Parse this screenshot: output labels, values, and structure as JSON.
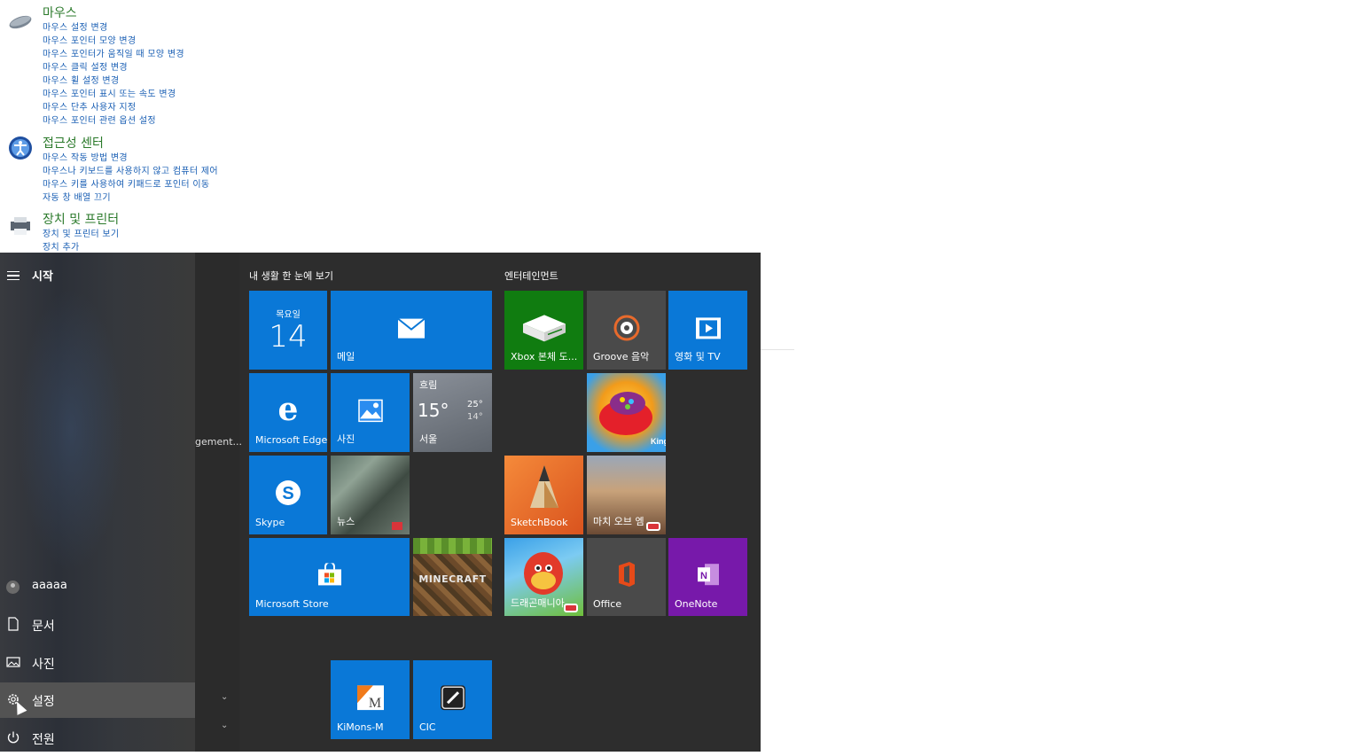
{
  "control_panel": {
    "mouse": {
      "title": "마우스",
      "links": [
        "마우스 설정 변경",
        "마우스 포인터 모양 변경",
        "마우스 포인터가 움직일 때 모양 변경",
        "마우스 클릭 설정 변경",
        "마우스 휠 설정 변경",
        "마우스 포인터 표시 또는 속도 변경",
        "마우스 단추 사용자 지정",
        "마우스 포인터 관련 옵션 설정"
      ]
    },
    "accessibility": {
      "title": "접근성 센터",
      "links": [
        "마우스 작동 방법 변경",
        "마우스나 키보드를 사용하지 않고 컴퓨터 제어",
        "마우스 키를 사용하여 키패드로 포인터 이동",
        "자동 창 배열 끄기"
      ]
    },
    "devices": {
      "title": "장치 및 프린터",
      "links": [
        "장치 및 프린터 보기",
        "장치 추가"
      ]
    }
  },
  "start_menu": {
    "header": "시작",
    "user": "aaaaa",
    "rail": [
      "문서",
      "사진",
      "설정",
      "전원"
    ],
    "truncated_app": "gement...",
    "group1_title": "내 생활 한 눈에 보기",
    "group2_title": "엔터테인먼트",
    "tiles": {
      "calendar_day": "목요일",
      "calendar_date": "14",
      "mail": "메일",
      "edge": "Microsoft Edge",
      "photos": "사진",
      "weather_cond": "흐림",
      "weather_temp": "15°",
      "weather_hi": "25°",
      "weather_lo": "14°",
      "weather_city": "서울",
      "skype": "Skype",
      "news": "뉴스",
      "store": "Microsoft Store",
      "xbox": "Xbox 본체 도...",
      "groove": "Groove 음악",
      "movies": "영화 및 TV",
      "sketchbook": "SketchBook",
      "march_of_empires": "마치 오브 엠",
      "dragon_mania": "드래곤매니아",
      "office": "Office",
      "onenote": "OneNote",
      "kimons": "KiMons-M",
      "cic": "CIC"
    }
  }
}
